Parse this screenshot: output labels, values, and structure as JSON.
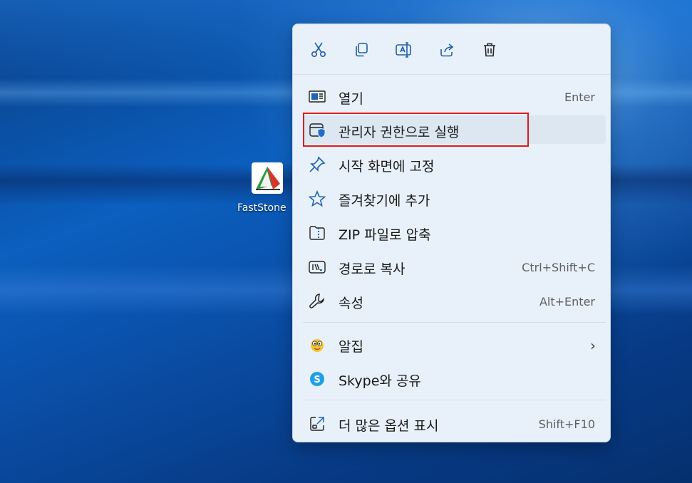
{
  "desktop": {
    "icon_label": "FastStone"
  },
  "toolbar": {
    "cut": "cut-icon",
    "copy": "copy-icon",
    "rename": "rename-icon",
    "share": "share-icon",
    "delete": "delete-icon"
  },
  "menu": {
    "items": [
      {
        "label": "열기",
        "shortcut": "Enter",
        "icon": "open-icon"
      },
      {
        "label": "관리자 권한으로 실행",
        "shortcut": "",
        "icon": "admin-shield-icon"
      },
      {
        "label": "시작 화면에 고정",
        "shortcut": "",
        "icon": "pin-icon"
      },
      {
        "label": "즐겨찾기에 추가",
        "shortcut": "",
        "icon": "star-icon"
      },
      {
        "label": "ZIP 파일로 압축",
        "shortcut": "",
        "icon": "zip-icon"
      },
      {
        "label": "경로로 복사",
        "shortcut": "Ctrl+Shift+C",
        "icon": "copy-path-icon"
      },
      {
        "label": "속성",
        "shortcut": "Alt+Enter",
        "icon": "wrench-icon"
      },
      {
        "label": "알집",
        "shortcut": "",
        "icon": "alzip-icon"
      },
      {
        "label": "Skype와 공유",
        "shortcut": "",
        "icon": "skype-icon"
      },
      {
        "label": "더 많은 옵션 표시",
        "shortcut": "Shift+F10",
        "icon": "more-options-icon"
      }
    ]
  },
  "colors": {
    "accent": "#0067c0",
    "highlight_border": "#e01a1a",
    "menu_bg": "#e8f1fa"
  }
}
